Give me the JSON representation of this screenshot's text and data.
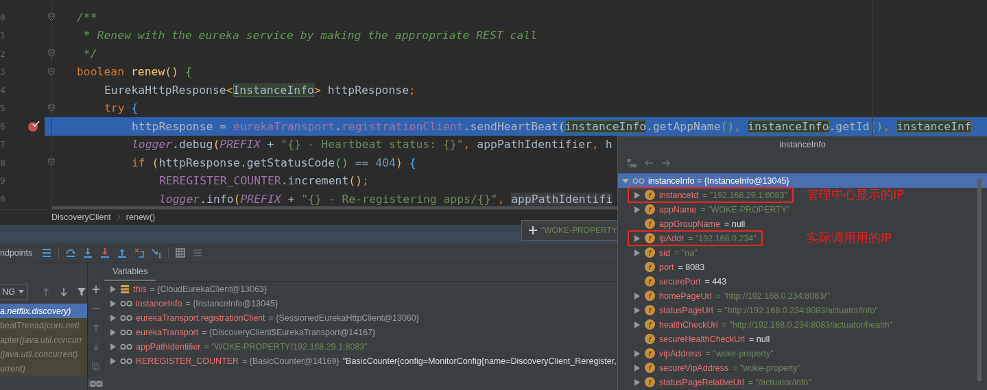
{
  "editor": {
    "lines": [
      {
        "number": "0",
        "fold": true,
        "breakpoint": false,
        "current": false,
        "tokens": [
          {
            "kind": "comment",
            "text": "/**"
          }
        ]
      },
      {
        "number": "1",
        "fold": false,
        "breakpoint": false,
        "current": false,
        "tokens": [
          {
            "kind": "comment",
            "text": " * Renew with the eureka service by making the appropriate REST call"
          }
        ]
      },
      {
        "number": "2",
        "fold": true,
        "breakpoint": false,
        "current": false,
        "tokens": [
          {
            "kind": "comment",
            "text": " */"
          }
        ]
      },
      {
        "number": "3",
        "fold": true,
        "breakpoint": false,
        "current": false,
        "tokens": [
          {
            "kind": "kw",
            "text": "boolean "
          },
          {
            "kind": "decl",
            "text": "renew"
          },
          {
            "kind": "b1",
            "text": "()"
          },
          {
            "kind": "b2",
            "text": " {"
          }
        ],
        "children": [
          {
            "number": "4",
            "fold": false,
            "breakpoint": false,
            "current": false,
            "tokens": [
              {
                "kind": "plain",
                "text": "EurekaHttpResponse"
              },
              {
                "kind": "gen",
                "text": "<"
              },
              {
                "kind": "hl",
                "text": "InstanceInfo"
              },
              {
                "kind": "gen",
                "text": ">"
              },
              {
                "kind": "plain",
                "text": " httpResponse"
              },
              {
                "kind": "kw",
                "text": ";"
              }
            ]
          },
          {
            "number": "5",
            "fold": true,
            "breakpoint": false,
            "current": false,
            "tokens": [
              {
                "kind": "kw",
                "text": "try"
              },
              {
                "kind": "b3",
                "text": " {"
              }
            ],
            "children": [
              {
                "number": "6",
                "fold": false,
                "breakpoint": true,
                "current": true,
                "tokens": [
                  {
                    "kind": "plain",
                    "text": "httpResponse = "
                  },
                  {
                    "kind": "field",
                    "text": "eurekaTransport"
                  },
                  {
                    "kind": "plain",
                    "text": "."
                  },
                  {
                    "kind": "field",
                    "text": "registrationClient"
                  },
                  {
                    "kind": "plain",
                    "text": ".sendHeartBeat"
                  },
                  {
                    "kind": "b1",
                    "text": "("
                  },
                  {
                    "kind": "hl",
                    "text": "instanceInfo"
                  },
                  {
                    "kind": "plain",
                    "text": ".getAppName"
                  },
                  {
                    "kind": "b2",
                    "text": "()"
                  },
                  {
                    "kind": "kw",
                    "text": ", "
                  },
                  {
                    "kind": "hl",
                    "text": "instanceInfo"
                  },
                  {
                    "kind": "plain",
                    "text": ".getId"
                  },
                  {
                    "kind": "b2",
                    "text": "()"
                  },
                  {
                    "kind": "kw",
                    "text": ", "
                  },
                  {
                    "kind": "hl",
                    "text": "instanceInf"
                  }
                ]
              },
              {
                "number": "7",
                "fold": false,
                "breakpoint": false,
                "current": false,
                "tokens": [
                  {
                    "kind": "static",
                    "text": "logger"
                  },
                  {
                    "kind": "plain",
                    "text": ".debug"
                  },
                  {
                    "kind": "b1",
                    "text": "("
                  },
                  {
                    "kind": "static",
                    "text": "PREFIX"
                  },
                  {
                    "kind": "plain",
                    "text": " + "
                  },
                  {
                    "kind": "string",
                    "text": "\"{} - Heartbeat status: {}\""
                  },
                  {
                    "kind": "kw",
                    "text": ", "
                  },
                  {
                    "kind": "plain",
                    "text": "appPathIdentifier"
                  },
                  {
                    "kind": "kw",
                    "text": ", "
                  },
                  {
                    "kind": "plain",
                    "text": "h"
                  }
                ]
              },
              {
                "number": "8",
                "fold": true,
                "breakpoint": false,
                "current": false,
                "tokens": [
                  {
                    "kind": "kw",
                    "text": "if "
                  },
                  {
                    "kind": "b1",
                    "text": "("
                  },
                  {
                    "kind": "plain",
                    "text": "httpResponse.getStatusCode"
                  },
                  {
                    "kind": "b2",
                    "text": "()"
                  },
                  {
                    "kind": "plain",
                    "text": " == "
                  },
                  {
                    "kind": "num",
                    "text": "404"
                  },
                  {
                    "kind": "b1",
                    "text": ")"
                  },
                  {
                    "kind": "b3",
                    "text": " {"
                  }
                ],
                "children": [
                  {
                    "number": "9",
                    "fold": false,
                    "breakpoint": false,
                    "current": false,
                    "tokens": [
                      {
                        "kind": "field",
                        "text": "REREGISTER_COUNTER"
                      },
                      {
                        "kind": "plain",
                        "text": ".increment"
                      },
                      {
                        "kind": "b1",
                        "text": "()"
                      },
                      {
                        "kind": "kw",
                        "text": ";"
                      }
                    ]
                  },
                  {
                    "number": "0",
                    "fold": false,
                    "breakpoint": false,
                    "current": false,
                    "tokens": [
                      {
                        "kind": "static",
                        "text": "logger"
                      },
                      {
                        "kind": "plain",
                        "text": ".info"
                      },
                      {
                        "kind": "b1",
                        "text": "("
                      },
                      {
                        "kind": "static",
                        "text": "PREFIX"
                      },
                      {
                        "kind": "plain",
                        "text": " + "
                      },
                      {
                        "kind": "string",
                        "text": "\"{} - Re-registering apps/{}\""
                      },
                      {
                        "kind": "kw",
                        "text": ", "
                      },
                      {
                        "kind": "ref",
                        "text": "appPathIdentifi"
                      }
                    ]
                  }
                ]
              }
            ]
          }
        ]
      }
    ]
  },
  "breadcrumb": [
    "DiscoveryClient",
    "renew()"
  ],
  "tooltip": {
    "text": "\"WOKE-PROPERTY"
  },
  "debugger": {
    "toolbar_label": "ndpoints",
    "toolbar": [
      {
        "kind": "list",
        "disabled": false
      },
      {
        "kind": "step-over",
        "disabled": false
      },
      {
        "kind": "step-into",
        "disabled": false
      },
      {
        "kind": "force-step-into",
        "disabled": false
      },
      {
        "kind": "step-out",
        "disabled": false
      },
      {
        "kind": "drop-frame",
        "disabled": false
      },
      {
        "kind": "run-to-cursor",
        "disabled": false
      },
      {
        "kind": "evaluate",
        "disabled": false
      },
      {
        "kind": "trace",
        "disabled": true
      }
    ],
    "thread": "NG",
    "frame_tools": [
      {
        "kind": "up",
        "disabled": true
      },
      {
        "kind": "down",
        "disabled": false
      },
      {
        "kind": "filter",
        "disabled": false
      }
    ],
    "frames": [
      {
        "package": "a.netflix.discovery)",
        "library": false,
        "selected": true
      },
      {
        "method": "beatThread",
        "package": "(com.neti",
        "library": true,
        "selected": false
      },
      {
        "method": "apter",
        "package": "(java.util.concurr",
        "library": true,
        "selected": false
      },
      {
        "package": "(java.util.concurrent)",
        "library": true,
        "selected": false
      },
      {
        "package": "urrent)",
        "library": true,
        "selected": false
      }
    ],
    "variables_tab": "Variables",
    "variable_tools": [
      {
        "kind": "add",
        "disabled": false
      },
      {
        "kind": "remove",
        "disabled": true
      },
      {
        "kind": "up",
        "disabled": true
      },
      {
        "kind": "down",
        "disabled": true
      },
      {
        "kind": "copy",
        "disabled": true
      }
    ],
    "watches_toggle": {
      "on": true
    },
    "variables": [
      {
        "kind": "object",
        "name": "this",
        "value": "= {CloudEurekaClient@13063}",
        "expanded": false
      },
      {
        "kind": "reference",
        "name": "instanceInfo",
        "value": "= {InstanceInfo@13045}",
        "expanded": false
      },
      {
        "kind": "reference",
        "name": "eurekaTransport.registrationClient",
        "value": "= {SessionedEurekaHttpClient@13060}",
        "expanded": false
      },
      {
        "kind": "reference",
        "name": "eurekaTransport",
        "value": "= {DiscoveryClient$EurekaTransport@14167}",
        "expanded": false
      },
      {
        "kind": "string",
        "name": "appPathIdentifier",
        "value": "= \"WOKE-PROPERTY/192.168.29.1:8083\"",
        "expanded": false
      },
      {
        "kind": "reference",
        "name": "REREGISTER_COUNTER",
        "value": "= {BasicCounter@14169}",
        "extra": "\"BasicCounter{config=MonitorConfig{name=DiscoveryClient_Reregister,",
        "expanded": false
      }
    ]
  },
  "popup": {
    "title": "instanceInfo",
    "nav": [
      {
        "kind": "tree",
        "disabled": true
      },
      {
        "kind": "back",
        "disabled": true
      },
      {
        "kind": "forward",
        "disabled": true
      }
    ],
    "root": {
      "label": "instanceInfo = {InstanceInfo@13045}",
      "expanded": true,
      "selected": true,
      "children": [
        {
          "kind": "string",
          "badge": "f",
          "name": "instanceId",
          "value": "= \"192.168.29.1:8083\"",
          "expandable": true,
          "highlight": true,
          "annotation": "管理中心显示的IP"
        },
        {
          "kind": "string",
          "badge": "f",
          "name": "appName",
          "value": "= \"WOKE-PROPERTY\"",
          "expandable": true,
          "highlight": false
        },
        {
          "kind": "plain",
          "badge": "f",
          "name": "appGroupName",
          "value": "= null",
          "expandable": false,
          "highlight": false
        },
        {
          "kind": "string",
          "badge": "f",
          "name": "ipAddr",
          "value": "= \"192.168.0.234\"",
          "expandable": true,
          "highlight": true,
          "annotation": "实际调用用的IP"
        },
        {
          "kind": "string",
          "badge": "f",
          "name": "sid",
          "value": "= \"na\"",
          "expandable": true,
          "highlight": false
        },
        {
          "kind": "plain",
          "badge": "f",
          "name": "port",
          "value": "= 8083",
          "expandable": false,
          "highlight": false
        },
        {
          "kind": "plain",
          "badge": "f",
          "name": "securePort",
          "value": "= 443",
          "expandable": false,
          "highlight": false
        },
        {
          "kind": "string",
          "badge": "f",
          "name": "homePageUrl",
          "value": "= \"http://192.168.0.234:8083/\"",
          "expandable": true,
          "highlight": false
        },
        {
          "kind": "string",
          "badge": "f",
          "name": "statusPageUrl",
          "value": "= \"http://192.168.0.234:8083/actuator/info\"",
          "expandable": true,
          "highlight": false
        },
        {
          "kind": "string",
          "badge": "f",
          "name": "healthCheckUrl",
          "value": "= \"http://192.168.0.234:8083/actuator/health\"",
          "expandable": true,
          "highlight": false
        },
        {
          "kind": "plain",
          "badge": "f",
          "name": "secureHealthCheckUrl",
          "value": "= null",
          "expandable": false,
          "highlight": false
        },
        {
          "kind": "string",
          "badge": "f",
          "name": "vipAddress",
          "value": "= \"woke-property\"",
          "expandable": true,
          "highlight": false
        },
        {
          "kind": "string",
          "badge": "f",
          "name": "secureVipAddress",
          "value": "= \"woke-property\"",
          "expandable": true,
          "highlight": false
        },
        {
          "kind": "string",
          "badge": "f",
          "name": "statusPageRelativeUrl",
          "value": "= \"/actuator/info\"",
          "expandable": true,
          "highlight": false
        }
      ]
    }
  }
}
